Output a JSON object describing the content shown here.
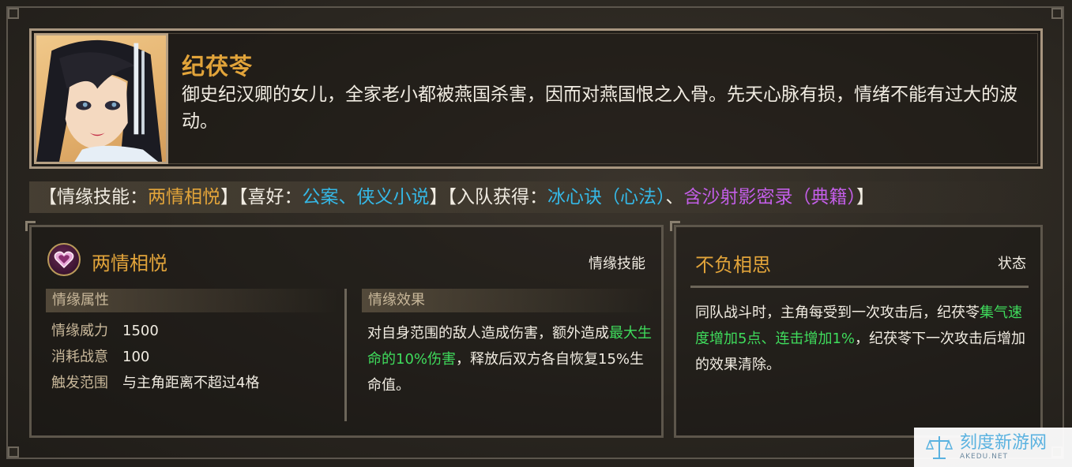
{
  "character": {
    "name": "纪茯苓",
    "description": "御史纪汉卿的女儿，全家老小都被燕国杀害，因而对燕国恨之入骨。先天心脉有损，情绪不能有过大的波动。"
  },
  "info_bar": {
    "open1": "【情缘技能：",
    "skill": "两情相悦",
    "close1": "】",
    "open2": "【喜好：",
    "likes": "公案、侠义小说",
    "close2": "】",
    "open3": "【入队获得：",
    "item1": "冰心诀（心法）",
    "sep": "、",
    "item2": "含沙射影密录（典籍）",
    "close3": "】"
  },
  "skill": {
    "name": "两情相悦",
    "type": "情缘技能",
    "icon": "heart-icon",
    "attr_header": "情缘属性",
    "attrs": [
      {
        "label": "情缘威力",
        "value": "1500"
      },
      {
        "label": "消耗战意",
        "value": "100"
      },
      {
        "label": "触发范围",
        "value": "与主角距离不超过4格"
      }
    ],
    "effect_header": "情缘效果",
    "effect_pre": "对自身范围的敌人造成伤害，额外造成",
    "effect_highlight": "最大生命的10%伤害",
    "effect_post": "，释放后双方各自恢复15%生命值。"
  },
  "status": {
    "name": "不负相思",
    "type": "状态",
    "text_pre": "同队战斗时，主角每受到一次攻击后，纪茯苓",
    "text_highlight": "集气速度增加5点、连击增加1%",
    "text_post": "，纪茯苓下一次攻击后增加的效果清除。"
  },
  "watermark": {
    "title": "刻度新游网",
    "sub": "AKEDU.NET"
  },
  "colors": {
    "gold": "#e2a43a",
    "cyan": "#35b8e6",
    "purple": "#c35ee8",
    "green": "#3fdc5c"
  }
}
